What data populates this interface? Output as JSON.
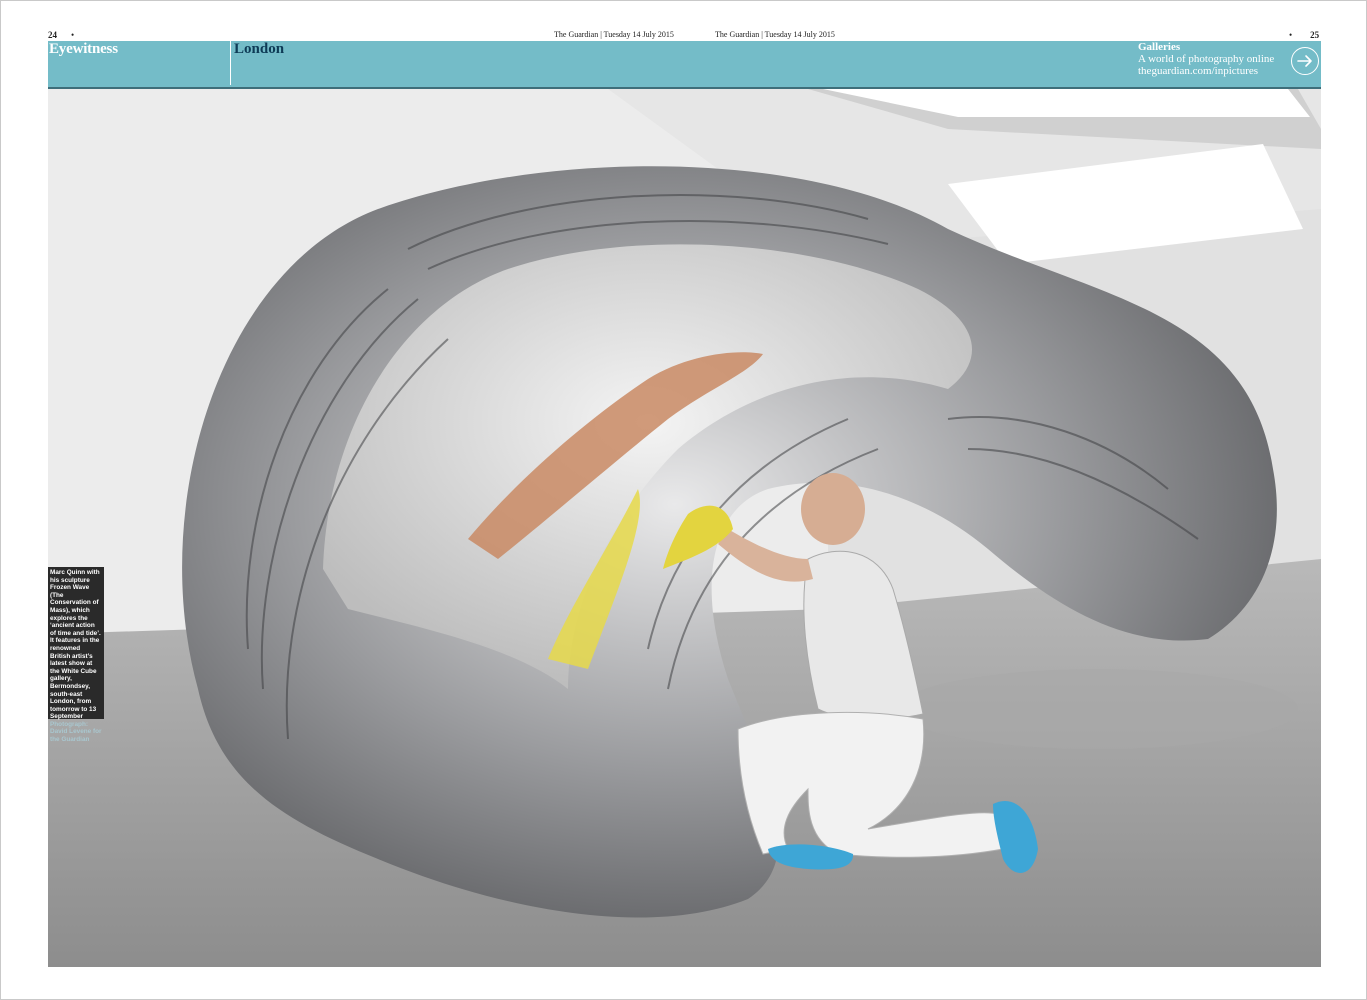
{
  "header": {
    "left_page_number": "24",
    "right_page_number": "25",
    "left_dateline": "The Guardian | Tuesday 14 July 2015",
    "right_dateline": "The Guardian | Tuesday 14 July 2015",
    "bullet": "•"
  },
  "banner": {
    "kicker": "Eyewitness",
    "section": "London",
    "galleries": {
      "title": "Galleries",
      "line1": "A world of photography online",
      "line2": "theguardian.com/inpictures"
    },
    "arrow_icon": "arrow-right-icon",
    "color": "#74bcc8"
  },
  "caption": {
    "text": "Marc Quinn with his sculpture Frozen Wave (The Conservation of Mass), which explores the ‘ancient action of time and tide’. It features in the renowned British artist’s latest show at the White Cube gallery, Bermondsey, south-east London, from tomorrow to 13 September",
    "credit": "Photograph: David Levene for the Guardian"
  }
}
